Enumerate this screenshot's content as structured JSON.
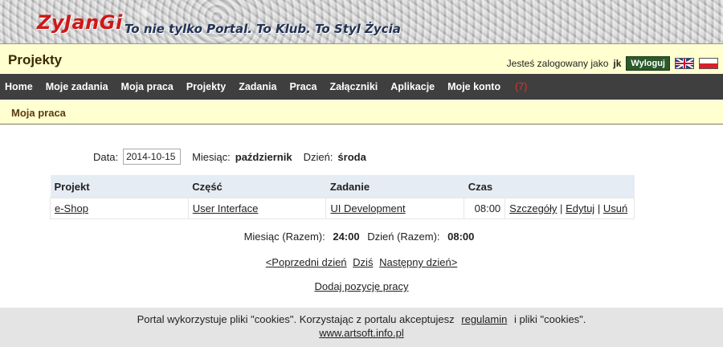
{
  "header": {
    "logo": "ZyJanGi",
    "slogan": "To nie tylko Portal. To Klub. To Styl Życia"
  },
  "titlebar": {
    "title": "Projekty",
    "logged_in_text": "Jesteś zalogowany jako",
    "username": "jk",
    "logout_label": "Wyloguj",
    "flags": [
      "english-flag-icon",
      "polish-flag-icon"
    ]
  },
  "nav": {
    "items": [
      "Home",
      "Moje zadania",
      "Moja praca",
      "Projekty",
      "Zadania",
      "Praca",
      "Załączniki",
      "Aplikacje",
      "Moje konto"
    ],
    "count": "(7)"
  },
  "section": {
    "title": "Moja praca"
  },
  "filter": {
    "date_label": "Data:",
    "date_value": "2014-10-15",
    "month_label": "Miesiąc:",
    "month_value": "październik",
    "day_label": "Dzień:",
    "day_value": "środa"
  },
  "table": {
    "headers": [
      "Projekt",
      "Część",
      "Zadanie",
      "Czas"
    ],
    "rows": [
      {
        "project": "e-Shop",
        "part": "User Interface",
        "task": "UI Development",
        "time": "08:00",
        "actions": [
          "Szczegóły",
          "Edytuj",
          "Usuń"
        ]
      }
    ]
  },
  "totals": {
    "month_label": "Miesiąc (Razem):",
    "month_value": "24:00",
    "day_label": "Dzień (Razem):",
    "day_value": "08:00"
  },
  "daynav": {
    "prev": "<Poprzedni dzień",
    "today": "Dziś",
    "next": "Następny dzień>"
  },
  "add_work": "Dodaj pozycję pracy",
  "footer": {
    "text_before": "Portal wykorzystuje pliki \"cookies\". Korzystając z portalu akceptujesz",
    "link": "regulamin",
    "text_after": "i pliki \"cookies\".",
    "website": "www.artsoft.info.pl"
  }
}
